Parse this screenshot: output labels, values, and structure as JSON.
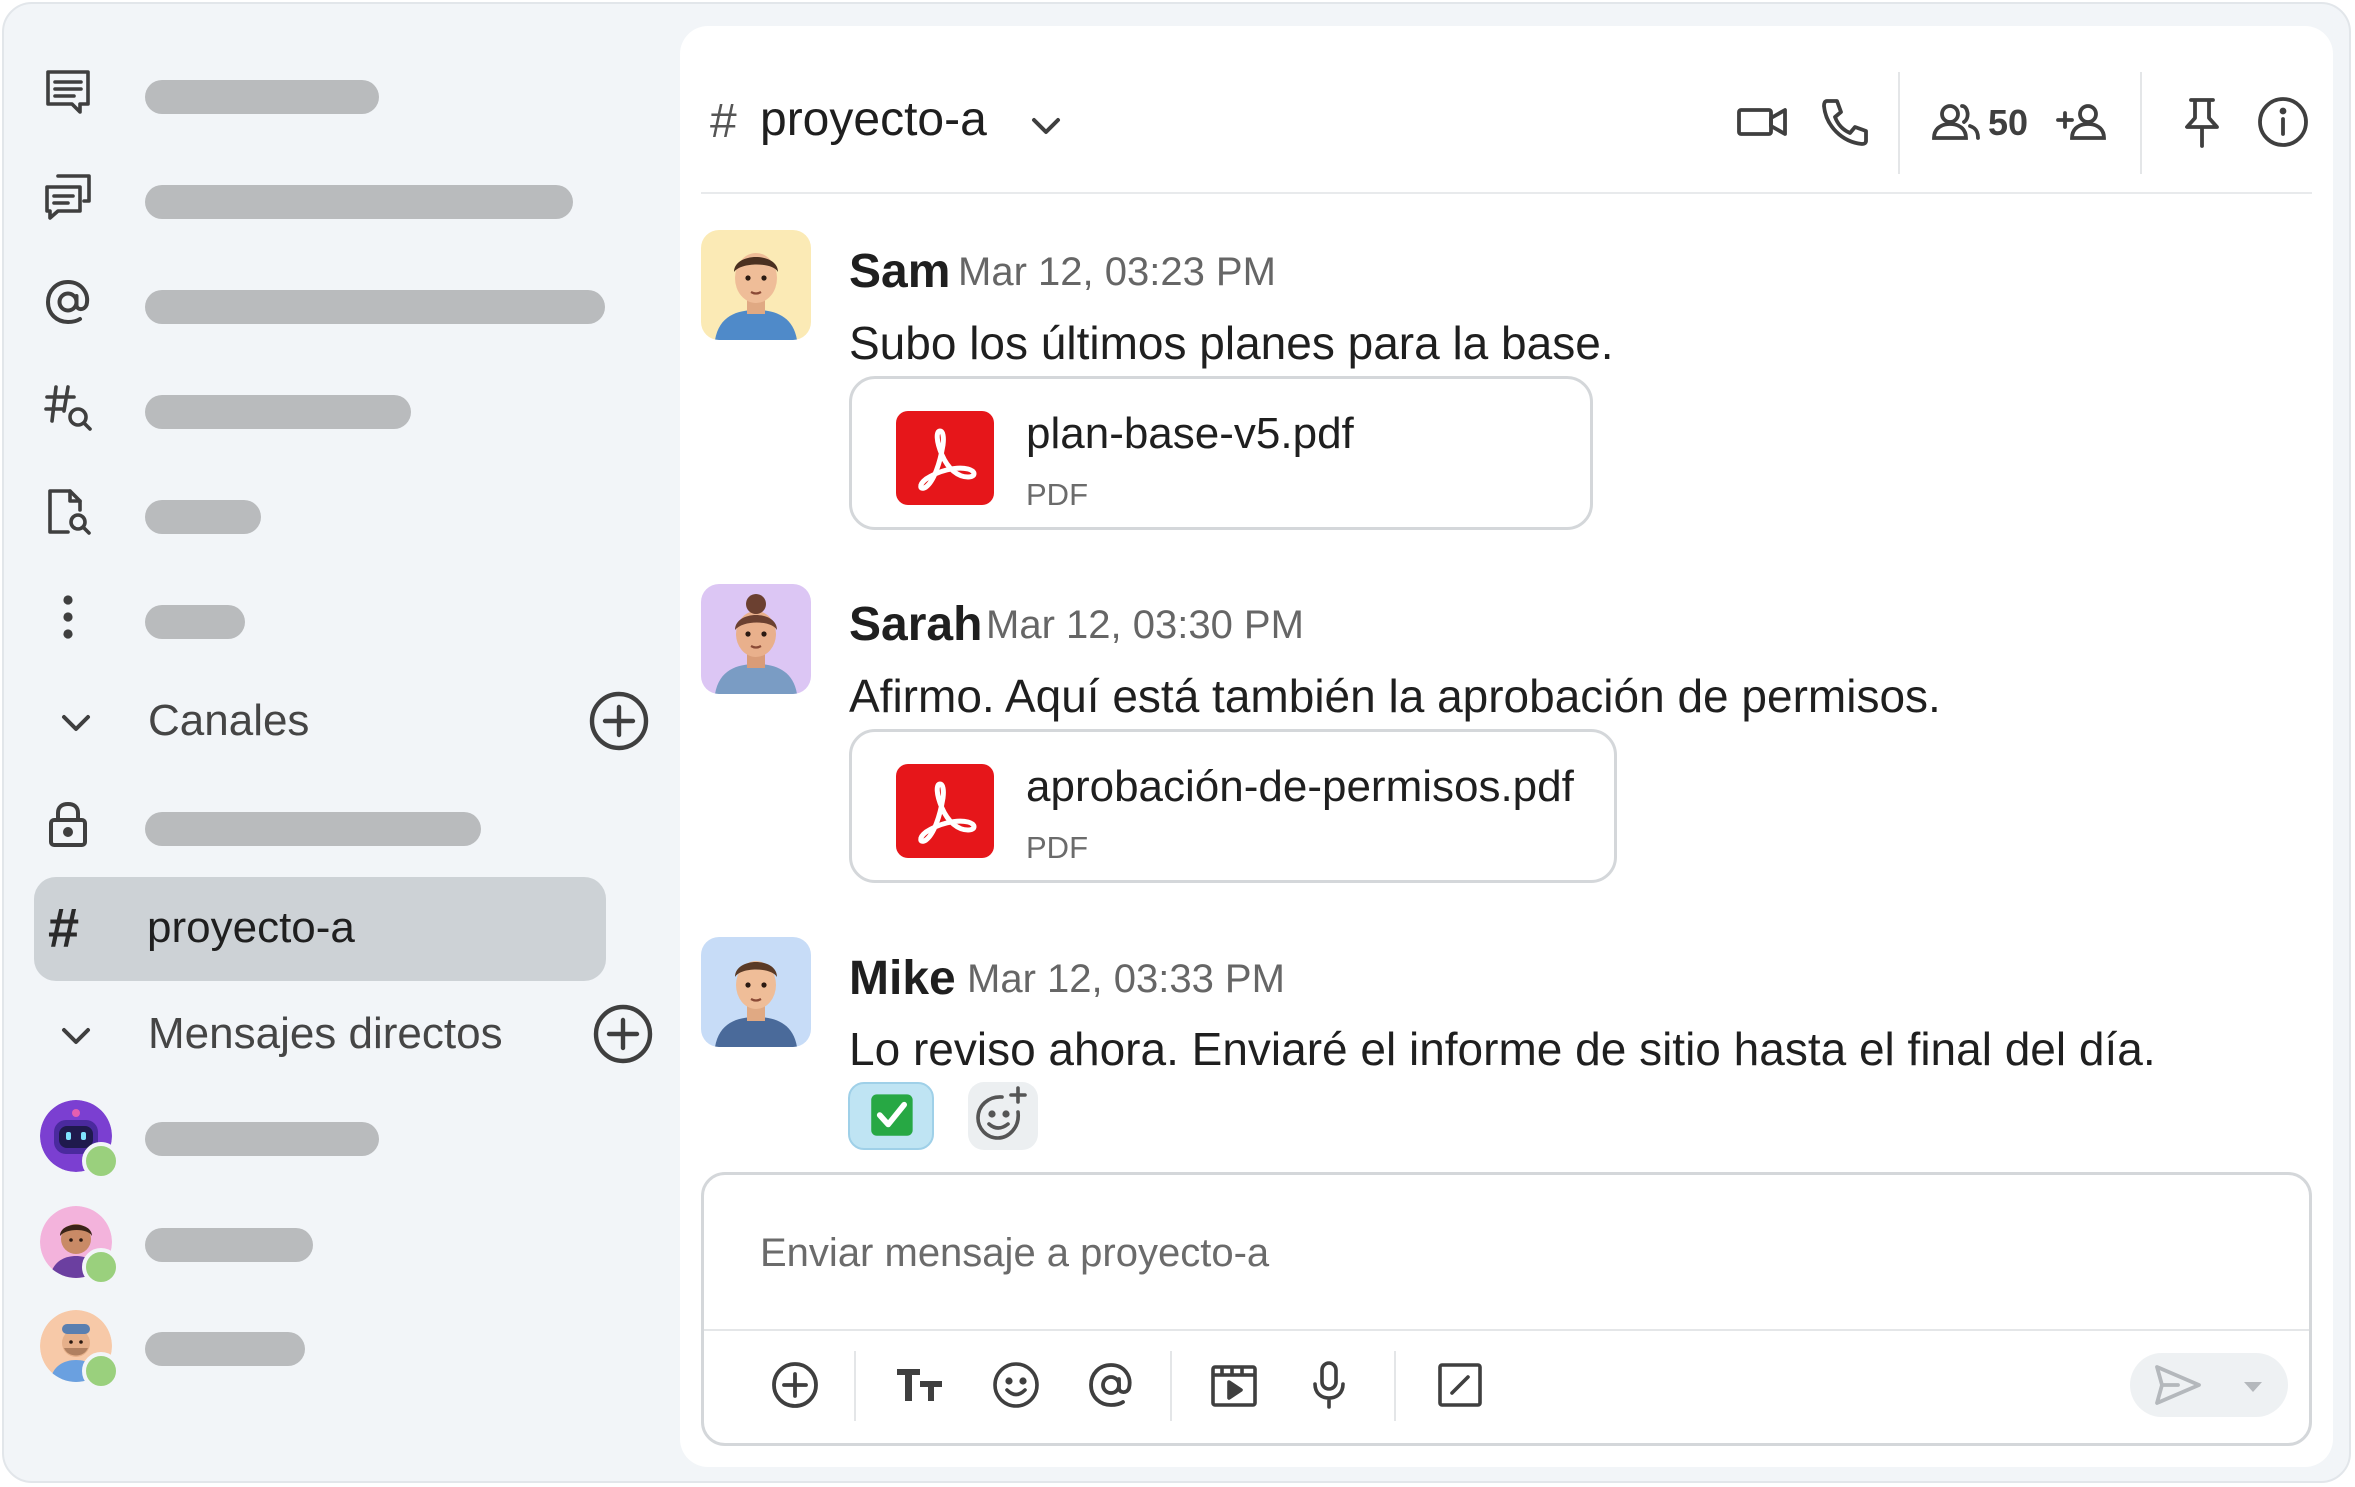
{
  "sidebar": {
    "nav_items": [
      {
        "icon": "threads-icon"
      },
      {
        "icon": "conversations-icon"
      },
      {
        "icon": "mentions-icon"
      },
      {
        "icon": "browse-channels-icon"
      },
      {
        "icon": "files-search-icon"
      },
      {
        "icon": "more-icon"
      }
    ],
    "channels_section": {
      "label": "Canales"
    },
    "private_channel_icon": "lock-icon",
    "active_channel": {
      "name": "proyecto-a",
      "hash": "#"
    },
    "dm_section": {
      "label": "Mensajes directos"
    },
    "status_color": "#9ad07d"
  },
  "header": {
    "hash": "#",
    "title": "proyecto-a",
    "member_count": "50",
    "icons": [
      "video-icon",
      "phone-icon",
      "members-icon",
      "add-member-icon",
      "pin-icon",
      "info-icon"
    ]
  },
  "messages": [
    {
      "author": "Sam",
      "time": "Mar 12, 03:23 PM",
      "text": "Subo los últimos planes para la base.",
      "file": {
        "name": "plan-base-v5.pdf",
        "type": "PDF"
      }
    },
    {
      "author": "Sarah",
      "time": "Mar 12, 03:30 PM",
      "text": "Afirmo. Aquí está también la aprobación de permisos.",
      "file": {
        "name": "aprobación-de-permisos.pdf",
        "type": "PDF"
      }
    },
    {
      "author": "Mike",
      "time": "Mar 12, 03:33 PM",
      "text": "Lo reviso ahora. Enviaré el informe de sitio hasta el final del día.",
      "reactions": [
        "check-mark-emoji",
        "add-reaction-icon"
      ]
    }
  ],
  "composer": {
    "placeholder": "Enviar mensaje a proyecto-a",
    "tools": [
      "add-icon",
      "formatting-icon",
      "emoji-icon",
      "mention-icon",
      "gif-icon",
      "microphone-icon",
      "slash-command-icon"
    ]
  },
  "colors": {
    "pdf_red": "#e6161a",
    "active_channel_bg": "#cdd2d6",
    "placeholder_bar": "#b9bbbd"
  }
}
